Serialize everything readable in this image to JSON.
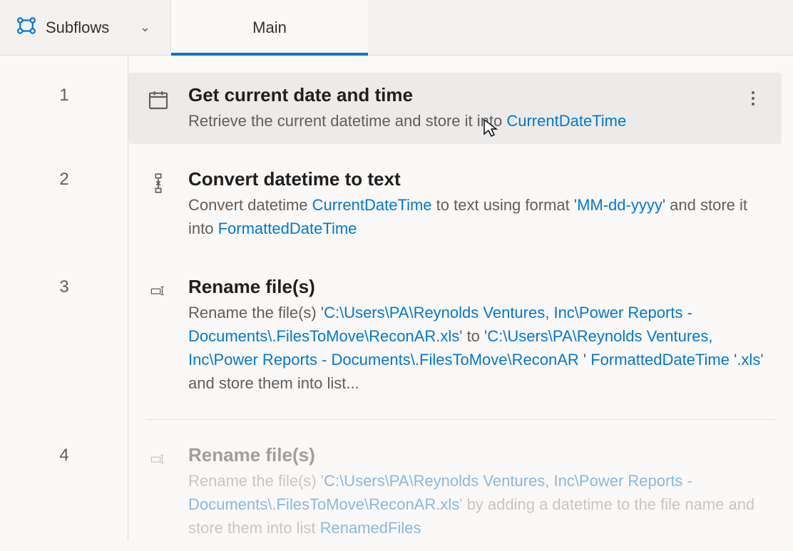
{
  "toolbar": {
    "subflows_label": "Subflows"
  },
  "tabs": [
    {
      "label": "Main",
      "active": true
    }
  ],
  "steps": [
    {
      "num": "1",
      "icon": "calendar",
      "selected": true,
      "title": "Get current date and time",
      "desc_parts": [
        {
          "t": "Retrieve the current datetime and store it into "
        },
        {
          "t": "CurrentDateTime",
          "cls": "var"
        }
      ]
    },
    {
      "num": "2",
      "icon": "convert",
      "title": "Convert datetime to text",
      "desc_parts": [
        {
          "t": "Convert datetime "
        },
        {
          "t": "CurrentDateTime",
          "cls": "var"
        },
        {
          "t": "  to text using format '"
        },
        {
          "t": "MM-dd-yyyy",
          "cls": "lit"
        },
        {
          "t": "' and store it into "
        },
        {
          "t": "FormattedDateTime",
          "cls": "var"
        }
      ]
    },
    {
      "num": "3",
      "icon": "rename",
      "title": "Rename file(s)",
      "desc_parts": [
        {
          "t": "Rename the file(s) '"
        },
        {
          "t": "C:\\Users\\PA\\Reynolds Ventures, Inc\\Power Reports - Documents\\.FilesToMove\\ReconAR.xls",
          "cls": "lit"
        },
        {
          "t": "' to '"
        },
        {
          "t": "C:\\Users\\PA\\Reynolds Ventures, Inc\\Power Reports - Documents\\.FilesToMove\\ReconAR ",
          "cls": "lit"
        },
        {
          "t": "' "
        },
        {
          "t": "FormattedDateTime",
          "cls": "var"
        },
        {
          "t": "  '"
        },
        {
          "t": ".xls",
          "cls": "lit"
        },
        {
          "t": "' and store them into list..."
        }
      ]
    },
    {
      "num": "4",
      "icon": "rename",
      "faded": true,
      "title": "Rename file(s)",
      "desc_parts": [
        {
          "t": "Rename the file(s) '"
        },
        {
          "t": "C:\\Users\\PA\\Reynolds Ventures, Inc\\Power Reports - Documents\\.FilesToMove\\ReconAR.xls",
          "cls": "lit"
        },
        {
          "t": "' by adding a datetime to the file name and store them into list "
        },
        {
          "t": "RenamedFiles",
          "cls": "var"
        }
      ]
    }
  ]
}
